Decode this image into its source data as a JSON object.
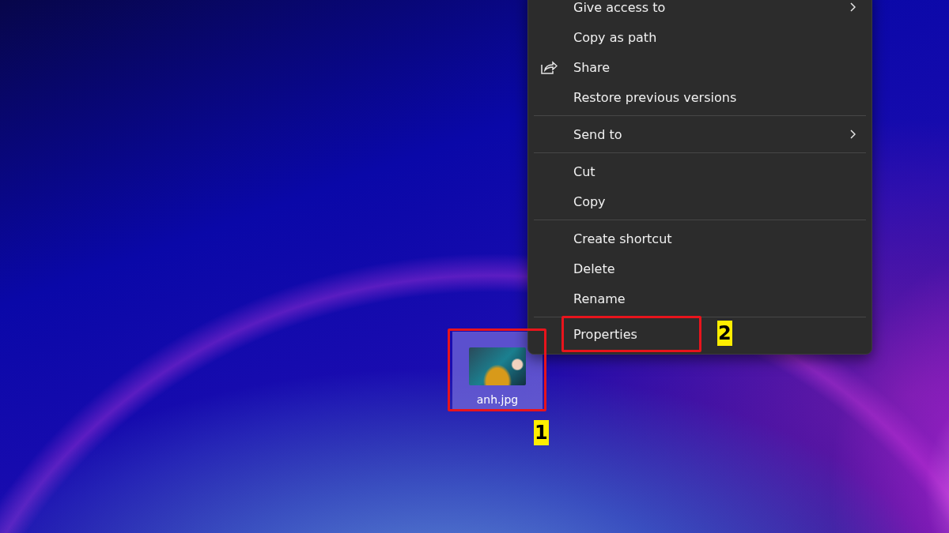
{
  "desktop_icon": {
    "label": "anh.jpg",
    "selected": true,
    "annotation": "1"
  },
  "context_menu": {
    "items": [
      {
        "kind": "item",
        "label": "Give access to",
        "submenu": true
      },
      {
        "kind": "item",
        "label": "Copy as path",
        "submenu": false
      },
      {
        "kind": "icon-item",
        "label": "Share",
        "submenu": false
      },
      {
        "kind": "item",
        "label": "Restore previous versions",
        "submenu": false
      },
      {
        "kind": "separator"
      },
      {
        "kind": "item",
        "label": "Send to",
        "submenu": true
      },
      {
        "kind": "separator"
      },
      {
        "kind": "item",
        "label": "Cut",
        "submenu": false
      },
      {
        "kind": "item",
        "label": "Copy",
        "submenu": false
      },
      {
        "kind": "separator"
      },
      {
        "kind": "item",
        "label": "Create shortcut",
        "submenu": false
      },
      {
        "kind": "item",
        "label": "Delete",
        "submenu": false
      },
      {
        "kind": "item",
        "label": "Rename",
        "submenu": false
      },
      {
        "kind": "separator"
      },
      {
        "kind": "item",
        "label": "Properties",
        "submenu": false,
        "annotation": "2"
      }
    ]
  }
}
